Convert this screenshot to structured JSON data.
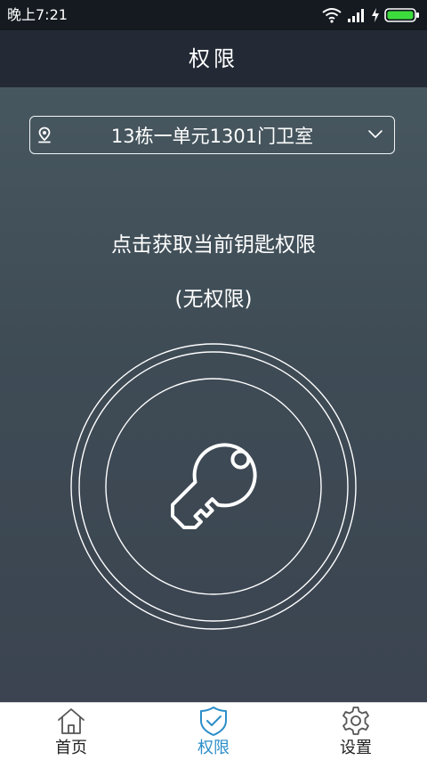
{
  "status_bar": {
    "time": "晚上7:21",
    "icons": [
      "wifi-icon",
      "signal-icon",
      "charging-icon",
      "battery-icon"
    ]
  },
  "title_bar": {
    "title": "权限"
  },
  "location_selector": {
    "icon": "location-pin-icon",
    "selected": "13栋一单元1301门卫室",
    "dropdown_icon": "chevron-down-icon"
  },
  "main": {
    "prompt": "点击获取当前钥匙权限",
    "permission_status": "(无权限)",
    "key_button_icon": "key-icon"
  },
  "bottom_nav": {
    "items": [
      {
        "label": "首页",
        "icon": "home-icon",
        "active": false
      },
      {
        "label": "权限",
        "icon": "shield-check-icon",
        "active": true
      },
      {
        "label": "设置",
        "icon": "gear-icon",
        "active": false
      }
    ]
  },
  "colors": {
    "status_bar_bg": "#141a20",
    "title_bar_bg": "#232a35",
    "main_bg_top": "#47575f",
    "main_bg_bottom": "#3b4450",
    "nav_active": "#2b8ec8",
    "nav_inactive": "#222222",
    "battery_green": "#3ddc3d"
  }
}
